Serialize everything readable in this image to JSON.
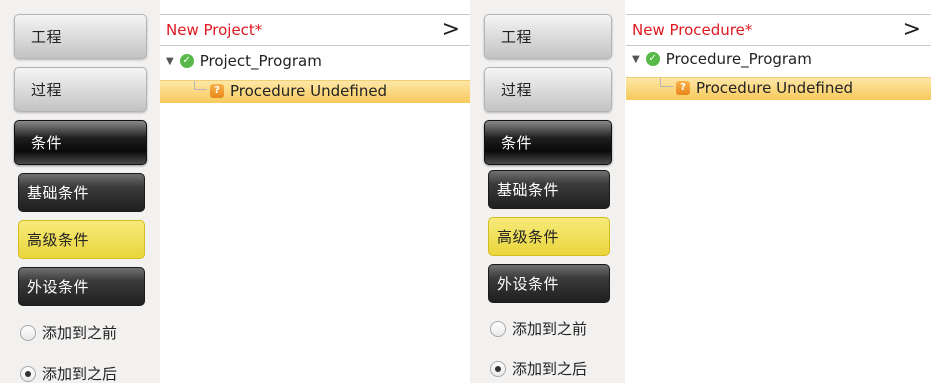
{
  "left": {
    "buttons": {
      "project": "工程",
      "process": "过程",
      "condition": "条件"
    },
    "conditions": {
      "basic": "基础条件",
      "advanced": "高级条件",
      "peripheral": "外设条件"
    },
    "radios": {
      "before": "添加到之前",
      "after": "添加到之后",
      "selected": "after"
    },
    "tree": {
      "header": "New Project*",
      "chevron": ">",
      "root": "Project_Program",
      "child": "Procedure Undefined"
    }
  },
  "right": {
    "buttons": {
      "project": "工程",
      "process": "过程",
      "condition": "条件"
    },
    "conditions": {
      "basic": "基础条件",
      "advanced": "高级条件",
      "peripheral": "外设条件"
    },
    "radios": {
      "before": "添加到之前",
      "after": "添加到之后",
      "selected": "after"
    },
    "tree": {
      "header": "New Procedure*",
      "chevron": ">",
      "root": "Procedure_Program",
      "child": "Procedure Undefined"
    }
  },
  "icons": {
    "expand": "triangle-down-icon",
    "status_ok": "check-circle-icon",
    "unknown": "question-icon",
    "chevron": "chevron-right-icon"
  },
  "colors": {
    "header_text": "#e0191f",
    "selection": "#f8c95b",
    "active_button": "#0a0a0a",
    "highlight_button": "#ead53c"
  }
}
